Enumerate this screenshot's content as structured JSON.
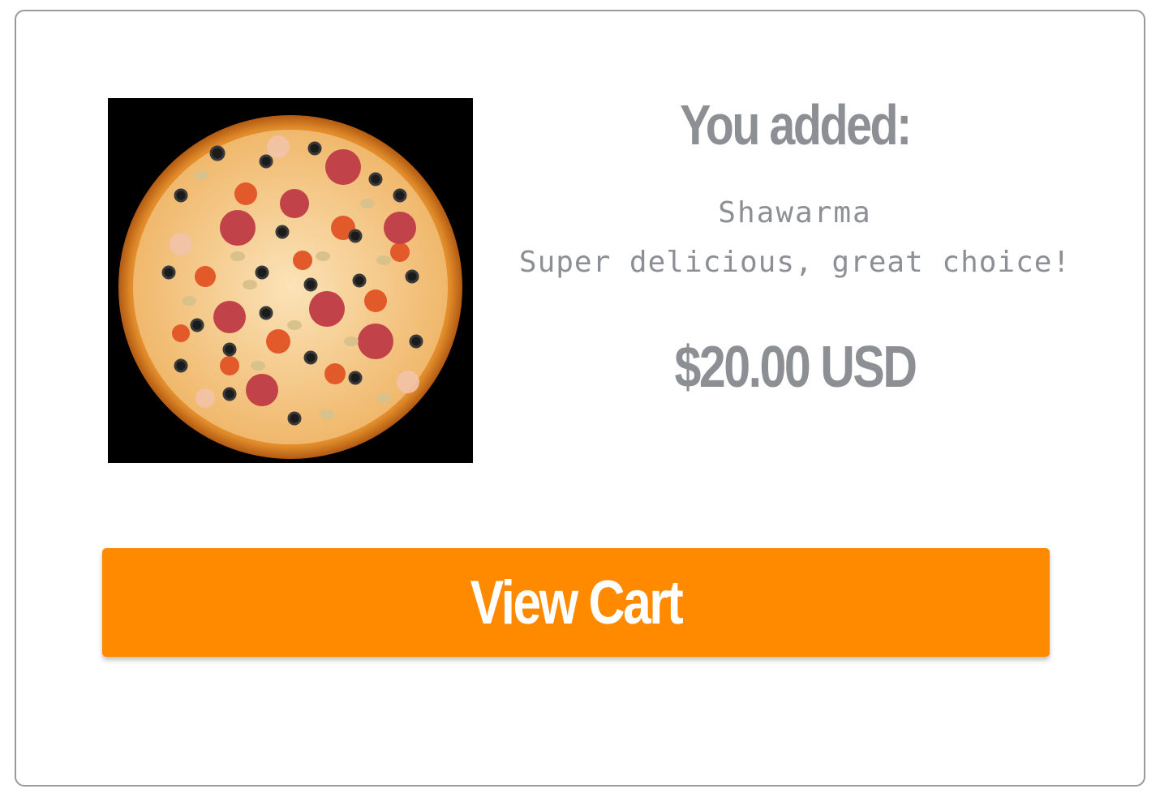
{
  "confirmation": {
    "heading": "You added:",
    "product_name": "Shawarma",
    "product_description": "Super delicious, great choice!",
    "price": "$20.00 USD",
    "image_icon": "pizza-photo"
  },
  "actions": {
    "view_cart_label": "View Cart"
  },
  "colors": {
    "accent": "#ff8a00",
    "text_muted": "#8c8f94",
    "image_background": "#000000"
  }
}
